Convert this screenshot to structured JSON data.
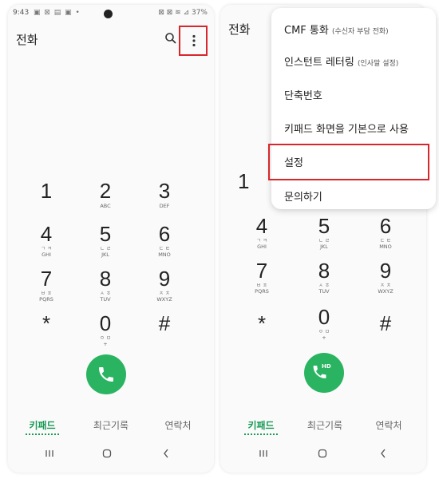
{
  "left": {
    "status": {
      "time": "9:43",
      "notif_icons": "▣ ⊠ ▤ ▣ •",
      "right_icons": "⊠ ⊠ ≋ ⊿",
      "battery": "37%"
    },
    "title": "전화"
  },
  "right": {
    "title": "전화"
  },
  "keypad": [
    {
      "digit": "1",
      "sub1": "",
      "sub2": ""
    },
    {
      "digit": "2",
      "sub1": "",
      "sub2": "ABC"
    },
    {
      "digit": "3",
      "sub1": "",
      "sub2": "DEF"
    },
    {
      "digit": "4",
      "sub1": "ㄱ ㅋ",
      "sub2": "GHI"
    },
    {
      "digit": "5",
      "sub1": "ㄴ ㄹ",
      "sub2": "JKL"
    },
    {
      "digit": "6",
      "sub1": "ㄷ ㅌ",
      "sub2": "MNO"
    },
    {
      "digit": "7",
      "sub1": "ㅂ ㅍ",
      "sub2": "PQRS"
    },
    {
      "digit": "8",
      "sub1": "ㅅ ㅎ",
      "sub2": "TUV"
    },
    {
      "digit": "9",
      "sub1": "ㅈ ㅊ",
      "sub2": "WXYZ"
    },
    {
      "digit": "*",
      "sub1": "",
      "sub2": ""
    },
    {
      "digit": "0",
      "sub1": "ㅇ ㅁ",
      "sub2": "+"
    },
    {
      "digit": "#",
      "sub1": "",
      "sub2": ""
    }
  ],
  "call_hd_label": "HD",
  "tabs": [
    "키패드",
    "최근기록",
    "연락처"
  ],
  "menu": {
    "items": [
      {
        "main": "CMF 통화",
        "sub": "(수신자 부담 전화)"
      },
      {
        "main": "인스턴트 레터링",
        "sub": "(인사말 설정)"
      },
      {
        "main": "단축번호",
        "sub": ""
      },
      {
        "main": "키패드 화면을 기본으로 사용",
        "sub": ""
      },
      {
        "main": "설정",
        "sub": ""
      },
      {
        "main": "문의하기",
        "sub": ""
      }
    ]
  },
  "colors": {
    "accent_green": "#2ab462",
    "tab_active": "#1a9a57",
    "highlight_red": "#d7262c"
  }
}
